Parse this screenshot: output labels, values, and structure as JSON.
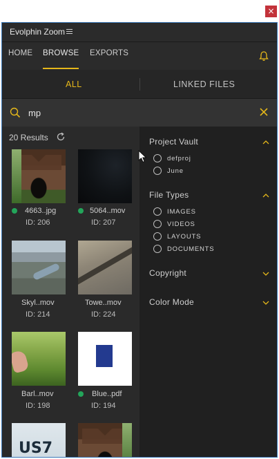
{
  "window": {
    "close_glyph": "×"
  },
  "app": {
    "title": "Evolphin Zoom"
  },
  "nav": {
    "items": [
      {
        "label": "HOME",
        "active": false
      },
      {
        "label": "BROWSE",
        "active": true
      },
      {
        "label": "EXPORTS",
        "active": false
      }
    ]
  },
  "tabs": [
    {
      "label": "ALL",
      "active": true
    },
    {
      "label": "LINKED FILES",
      "active": false
    }
  ],
  "search": {
    "value": "mp"
  },
  "results": {
    "count_label": "20 Results",
    "items": [
      {
        "name": "4663..jpg",
        "id_label": "ID: 206",
        "synced": true,
        "thumb": "covered-bridge"
      },
      {
        "name": "5064..mov",
        "id_label": "ID: 207",
        "synced": true,
        "thumb": "dark-frame"
      },
      {
        "name": "Skyl..mov",
        "id_label": "ID: 214",
        "synced": false,
        "thumb": "aerial-city"
      },
      {
        "name": "Towe..mov",
        "id_label": "ID: 224",
        "synced": false,
        "thumb": "aerial-bridge"
      },
      {
        "name": "Barl..mov",
        "id_label": "ID: 198",
        "synced": false,
        "thumb": "barley-field"
      },
      {
        "name": "Blue..pdf",
        "id_label": "ID: 194",
        "synced": true,
        "thumb": "blue-document"
      },
      {
        "name": "",
        "id_label": "",
        "synced": false,
        "thumb": "text-graphic",
        "visible_text": "US7"
      },
      {
        "name": "",
        "id_label": "",
        "synced": false,
        "thumb": "covered-bridge"
      }
    ]
  },
  "filters": {
    "sections": [
      {
        "title": "Project Vault",
        "expanded": true,
        "options": [
          "defproj",
          "June"
        ]
      },
      {
        "title": "File Types",
        "expanded": true,
        "options": [
          "IMAGES",
          "VIDEOS",
          "LAYOUTS",
          "DOCUMENTS"
        ]
      },
      {
        "title": "Copyright",
        "expanded": false,
        "options": []
      },
      {
        "title": "Color Mode",
        "expanded": false,
        "options": []
      }
    ]
  },
  "colors": {
    "accent": "#e6b81a",
    "synced_dot": "#23a55a",
    "window_border": "#3a78b8",
    "close_button": "#c3323a"
  },
  "icons": [
    "hamburger-icon",
    "bell-icon",
    "search-icon",
    "clear-icon",
    "refresh-icon",
    "chevron-up-icon",
    "chevron-down-icon",
    "close-icon"
  ]
}
